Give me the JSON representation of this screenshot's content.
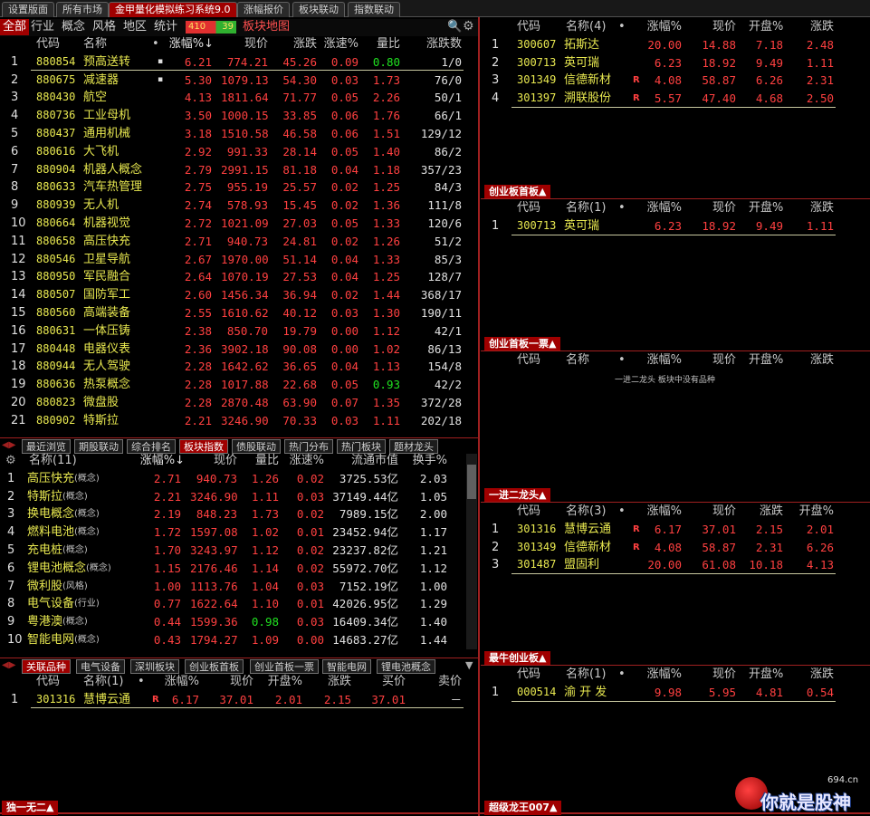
{
  "top_tabs": [
    "设置版面",
    "所有市场",
    "金甲量化模拟练习系统9.0",
    "涨幅报价",
    "板块联动",
    "指数联动"
  ],
  "filter_tabs": [
    "全部",
    "行业",
    "概念",
    "风格",
    "地区",
    "统计"
  ],
  "counter": {
    "up": "410",
    "down": "39"
  },
  "map_label": "板块地图",
  "sector_table": {
    "headers": [
      "代码",
      "名称",
      "•",
      "涨幅%↓",
      "现价",
      "涨跌",
      "涨速%",
      "量比",
      "涨跌数"
    ],
    "rows": [
      [
        "1",
        "880854",
        "预高送转",
        "▪",
        "6.21",
        "774.21",
        "45.26",
        "0.09",
        "0.80",
        "1/0"
      ],
      [
        "2",
        "880675",
        "减速器",
        "▪",
        "5.30",
        "1079.13",
        "54.30",
        "0.03",
        "1.73",
        "76/0"
      ],
      [
        "3",
        "880430",
        "航空",
        "",
        "4.13",
        "1811.64",
        "71.77",
        "0.05",
        "2.26",
        "50/1"
      ],
      [
        "4",
        "880736",
        "工业母机",
        "",
        "3.50",
        "1000.15",
        "33.85",
        "0.06",
        "1.76",
        "66/1"
      ],
      [
        "5",
        "880437",
        "通用机械",
        "",
        "3.18",
        "1510.58",
        "46.58",
        "0.06",
        "1.51",
        "129/12"
      ],
      [
        "6",
        "880616",
        "大飞机",
        "",
        "2.92",
        "991.33",
        "28.14",
        "0.05",
        "1.40",
        "86/2"
      ],
      [
        "7",
        "880904",
        "机器人概念",
        "",
        "2.79",
        "2991.15",
        "81.18",
        "0.04",
        "1.18",
        "357/23"
      ],
      [
        "8",
        "880633",
        "汽车热管理",
        "",
        "2.75",
        "955.19",
        "25.57",
        "0.02",
        "1.25",
        "84/3"
      ],
      [
        "9",
        "880939",
        "无人机",
        "",
        "2.74",
        "578.93",
        "15.45",
        "0.02",
        "1.36",
        "111/8"
      ],
      [
        "10",
        "880664",
        "机器视觉",
        "",
        "2.72",
        "1021.09",
        "27.03",
        "0.05",
        "1.33",
        "120/6"
      ],
      [
        "11",
        "880658",
        "高压快充",
        "",
        "2.71",
        "940.73",
        "24.81",
        "0.02",
        "1.26",
        "51/2"
      ],
      [
        "12",
        "880546",
        "卫星导航",
        "",
        "2.67",
        "1970.00",
        "51.14",
        "0.04",
        "1.33",
        "85/3"
      ],
      [
        "13",
        "880950",
        "军民融合",
        "",
        "2.64",
        "1070.19",
        "27.53",
        "0.04",
        "1.25",
        "128/7"
      ],
      [
        "14",
        "880507",
        "国防军工",
        "",
        "2.60",
        "1456.34",
        "36.94",
        "0.02",
        "1.44",
        "368/17"
      ],
      [
        "15",
        "880560",
        "高端装备",
        "",
        "2.55",
        "1610.62",
        "40.12",
        "0.03",
        "1.30",
        "190/11"
      ],
      [
        "16",
        "880631",
        "一体压铸",
        "",
        "2.38",
        "850.70",
        "19.79",
        "0.00",
        "1.12",
        "42/1"
      ],
      [
        "17",
        "880448",
        "电器仪表",
        "",
        "2.36",
        "3902.18",
        "90.08",
        "0.00",
        "1.02",
        "86/13"
      ],
      [
        "18",
        "880944",
        "无人驾驶",
        "",
        "2.28",
        "1642.62",
        "36.65",
        "0.04",
        "1.13",
        "154/8"
      ],
      [
        "19",
        "880636",
        "热泵概念",
        "",
        "2.28",
        "1017.88",
        "22.68",
        "0.05",
        "0.93",
        "42/2"
      ],
      [
        "20",
        "880823",
        "微盘股",
        "",
        "2.28",
        "2870.48",
        "63.90",
        "0.07",
        "1.35",
        "372/28"
      ],
      [
        "21",
        "880902",
        "特斯拉",
        "",
        "2.21",
        "3246.90",
        "70.33",
        "0.03",
        "1.11",
        "202/18"
      ]
    ]
  },
  "mid_tabs": [
    "最近浏览",
    "期股联动",
    "综合排名",
    "板块指数",
    "债股联动",
    "热门分布",
    "热门板块",
    "题材龙头"
  ],
  "index_table": {
    "headers": [
      "名称(11)",
      "涨幅%↓",
      "现价",
      "量比",
      "涨速%",
      "流通市值",
      "换手%"
    ],
    "rows": [
      [
        "1",
        "高压快充",
        "(概念)",
        "2.71",
        "940.73",
        "1.26",
        "0.02",
        "3725.53亿",
        "2.03"
      ],
      [
        "2",
        "特斯拉",
        "(概念)",
        "2.21",
        "3246.90",
        "1.11",
        "0.03",
        "37149.44亿",
        "1.05"
      ],
      [
        "3",
        "换电概念",
        "(概念)",
        "2.19",
        "848.23",
        "1.73",
        "0.02",
        "7989.15亿",
        "2.00"
      ],
      [
        "4",
        "燃料电池",
        "(概念)",
        "1.72",
        "1597.08",
        "1.02",
        "0.01",
        "23452.94亿",
        "1.17"
      ],
      [
        "5",
        "充电桩",
        "(概念)",
        "1.70",
        "3243.97",
        "1.12",
        "0.02",
        "23237.82亿",
        "1.21"
      ],
      [
        "6",
        "锂电池概念",
        "(概念)",
        "1.15",
        "2176.46",
        "1.14",
        "0.02",
        "55972.70亿",
        "1.12"
      ],
      [
        "7",
        "微利股",
        "(风格)",
        "1.00",
        "1113.76",
        "1.04",
        "0.03",
        "7152.19亿",
        "1.00"
      ],
      [
        "8",
        "电气设备",
        "(行业)",
        "0.77",
        "1622.64",
        "1.10",
        "0.01",
        "42026.95亿",
        "1.29"
      ],
      [
        "9",
        "粤港澳",
        "(概念)",
        "0.44",
        "1599.36",
        "0.98",
        "0.03",
        "16409.34亿",
        "1.40"
      ],
      [
        "10",
        "智能电网",
        "(概念)",
        "0.43",
        "1794.27",
        "1.09",
        "0.00",
        "14683.27亿",
        "1.44"
      ]
    ]
  },
  "bottom_tabs": [
    "关联品种",
    "电气设备",
    "深圳板块",
    "创业板首板",
    "创业首板一票",
    "智能电网",
    "锂电池概念"
  ],
  "related_table": {
    "headers": [
      "代码",
      "名称(1)",
      "•",
      "涨幅%",
      "现价",
      "开盘%",
      "涨跌",
      "买价",
      "卖价"
    ],
    "rows": [
      [
        "1",
        "301316",
        "慧博云通",
        "R",
        "6.17",
        "37.01",
        "2.01",
        "2.15",
        "37.01",
        "－"
      ]
    ]
  },
  "bottom_left_label": "独一无二▲",
  "right_panels": [
    {
      "label": "",
      "headers": [
        "代码",
        "名称(4)",
        "•",
        "涨幅%",
        "现价",
        "开盘%",
        "涨跌"
      ],
      "rows": [
        [
          "1",
          "300607",
          "拓斯达",
          "",
          "20.00",
          "14.88",
          "7.18",
          "2.48"
        ],
        [
          "2",
          "300713",
          "英可瑞",
          "",
          "6.23",
          "18.92",
          "9.49",
          "1.11"
        ],
        [
          "3",
          "301349",
          "信德新材",
          "R",
          "4.08",
          "58.87",
          "6.26",
          "2.31"
        ],
        [
          "4",
          "301397",
          "溯联股份",
          "R",
          "5.57",
          "47.40",
          "4.68",
          "2.50"
        ]
      ],
      "message": ""
    },
    {
      "label": "创业板首板▲",
      "headers": [
        "代码",
        "名称(1)",
        "•",
        "涨幅%",
        "现价",
        "开盘%",
        "涨跌"
      ],
      "rows": [
        [
          "1",
          "300713",
          "英可瑞",
          "",
          "6.23",
          "18.92",
          "9.49",
          "1.11"
        ]
      ],
      "message": ""
    },
    {
      "label": "创业首板一票▲",
      "headers": [
        "代码",
        "名称",
        "•",
        "涨幅%",
        "现价",
        "开盘%",
        "涨跌"
      ],
      "rows": [],
      "message": "一进二龙头 板块中没有品种"
    },
    {
      "label": "一进二龙头▲",
      "headers": [
        "代码",
        "名称(3)",
        "•",
        "涨幅%",
        "现价",
        "涨跌",
        "开盘%"
      ],
      "rows": [
        [
          "1",
          "301316",
          "慧博云通",
          "R",
          "6.17",
          "37.01",
          "2.15",
          "2.01"
        ],
        [
          "2",
          "301349",
          "信德新材",
          "R",
          "4.08",
          "58.87",
          "2.31",
          "6.26"
        ],
        [
          "3",
          "301487",
          "盟固利",
          "",
          "20.00",
          "61.08",
          "10.18",
          "4.13"
        ]
      ],
      "message": ""
    },
    {
      "label": "最牛创业板▲",
      "headers": [
        "代码",
        "名称(1)",
        "•",
        "涨幅%",
        "现价",
        "开盘%",
        "涨跌"
      ],
      "rows": [
        [
          "1",
          "000514",
          "渝 开 发",
          "",
          "9.98",
          "5.95",
          "4.81",
          "0.54"
        ]
      ],
      "message": ""
    }
  ],
  "bottom_right_label": "超级龙王007▲",
  "watermark": {
    "text": "你就是股神",
    "site": "694.cn"
  }
}
